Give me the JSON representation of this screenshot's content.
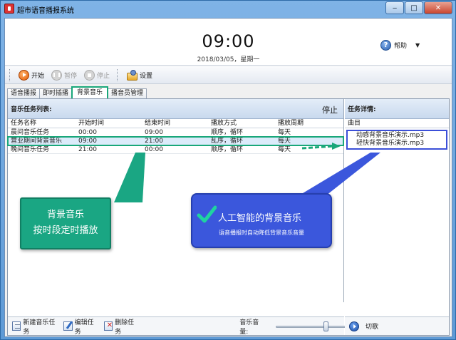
{
  "window": {
    "title": "超市语音播报系统"
  },
  "header": {
    "clock": "09:00",
    "date": "2018/03/05，星期一",
    "help_label": "帮助"
  },
  "toolbar": {
    "start": "开始",
    "pause": "暂停",
    "stop": "停止",
    "settings": "设置"
  },
  "tabs": [
    "语音播报",
    "即时插播",
    "背景音乐",
    "播音员管理"
  ],
  "music_list": {
    "heading": "音乐任务列表:",
    "status": "停止",
    "columns": [
      "任务名称",
      "开始时间",
      "结束时间",
      "播放方式",
      "播放周期"
    ],
    "rows": [
      [
        "晨间音乐任务",
        "00:00",
        "09:00",
        "顺序，循环",
        "每天"
      ],
      [
        "营业期间背景音乐",
        "09:00",
        "21:00",
        "乱序，循环",
        "每天"
      ],
      [
        "晚间音乐任务",
        "21:00",
        "00:00",
        "顺序，循环",
        "每天"
      ]
    ]
  },
  "details": {
    "heading": "任务详情:",
    "column": "曲目",
    "songs": [
      "动感背景音乐演示.mp3",
      "轻快背景音乐演示.mp3"
    ]
  },
  "bottom": {
    "new_task": "新建音乐任务",
    "edit_task": "编辑任务",
    "delete_task": "删除任务",
    "volume_label": "音乐音量:",
    "volume_level": 0.65,
    "next_song": "切歌"
  },
  "callouts": {
    "green": [
      "背景音乐",
      "按时段定时播放"
    ],
    "blue_title": "人工智能的背景音乐",
    "blue_sub": "语音播报时自动降低背景音乐音量"
  },
  "colors": {
    "accent_green": "#1aa683",
    "accent_blue": "#3b57dc"
  }
}
